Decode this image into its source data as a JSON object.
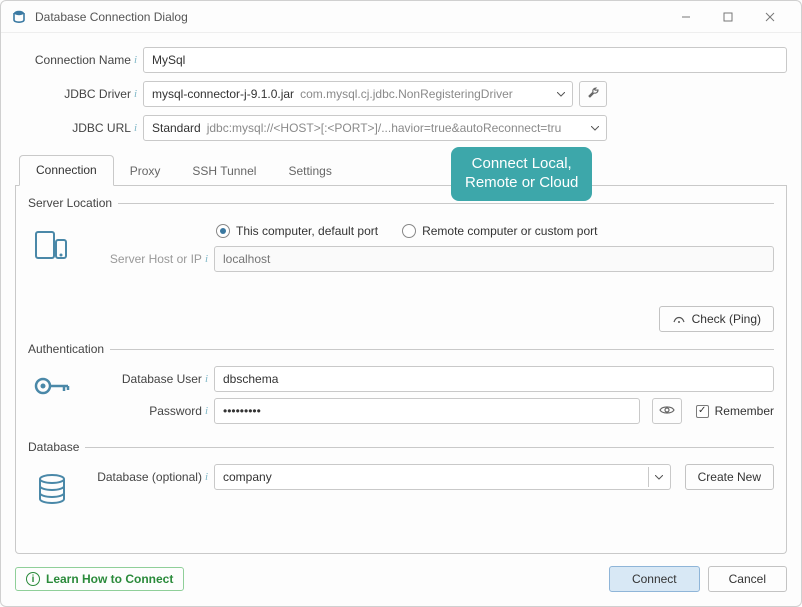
{
  "window": {
    "title": "Database Connection Dialog"
  },
  "labels": {
    "connection_name": "Connection Name",
    "jdbc_driver": "JDBC Driver",
    "jdbc_url": "JDBC URL"
  },
  "connection_name": {
    "value": "MySql"
  },
  "jdbc_driver": {
    "file": "mysql-connector-j-9.1.0.jar",
    "class": "com.mysql.cj.jdbc.NonRegisteringDriver"
  },
  "jdbc_url": {
    "mode": "Standard",
    "template": "jdbc:mysql://<HOST>[:<PORT>]/...havior=true&autoReconnect=tru"
  },
  "tabs": {
    "connection": "Connection",
    "proxy": "Proxy",
    "ssh": "SSH Tunnel",
    "settings": "Settings"
  },
  "server_location": {
    "legend": "Server Location",
    "radio_local": "This computer, default port",
    "radio_remote": "Remote computer or custom port",
    "host_label": "Server Host or IP",
    "host_value": "localhost",
    "check_ping": "Check (Ping)"
  },
  "auth": {
    "legend": "Authentication",
    "user_label": "Database User",
    "user_value": "dbschema",
    "password_label": "Password",
    "password_mask": "•••••••••",
    "remember": "Remember"
  },
  "database": {
    "legend": "Database",
    "label": "Database (optional)",
    "value": "company",
    "create_new": "Create New"
  },
  "callout": {
    "line1": "Connect Local,",
    "line2": "Remote or Cloud"
  },
  "footer": {
    "learn": "Learn How to Connect",
    "connect": "Connect",
    "cancel": "Cancel"
  }
}
